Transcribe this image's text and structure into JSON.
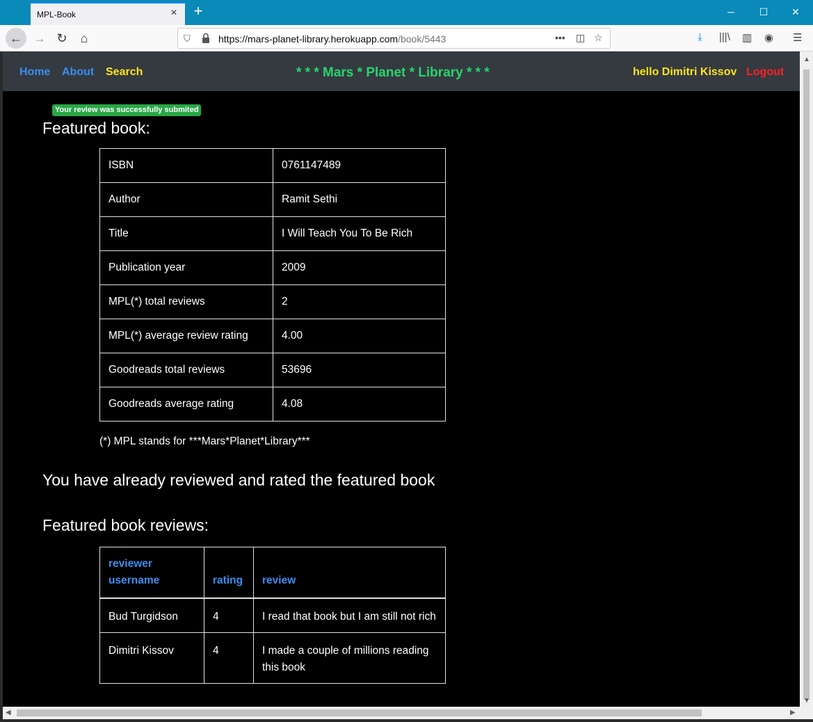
{
  "browser": {
    "tab_title": "MPL-Book",
    "url_host": "https://mars-planet-library.herokuapp.com",
    "url_path": "/book/5443",
    "colors": {
      "titlebar": "#0a8ab8",
      "tab_accent": "#0a84ff"
    }
  },
  "nav": {
    "home": "Home",
    "about": "About",
    "search": "Search",
    "brand": "* * * Mars * Planet * Library * * *",
    "greeting": "hello Dimitri Kissov",
    "logout": "Logout",
    "colors": {
      "link": "#3b8ef0",
      "search": "#ffe319",
      "brand": "#28d46c",
      "logout": "#ff2020"
    }
  },
  "flash_message": "Your review was successfully submited",
  "featured_heading": "Featured book:",
  "book": [
    {
      "label": "ISBN",
      "value": "0761147489"
    },
    {
      "label": "Author",
      "value": "Ramit Sethi"
    },
    {
      "label": "Title",
      "value": "I Will Teach You To Be Rich"
    },
    {
      "label": "Publication year",
      "value": "2009"
    },
    {
      "label": "MPL(*) total reviews",
      "value": "2"
    },
    {
      "label": "MPL(*) average review rating",
      "value": "4.00"
    },
    {
      "label": "Goodreads total reviews",
      "value": "53696"
    },
    {
      "label": "Goodreads average rating",
      "value": "4.08"
    }
  ],
  "footnote": "(*) MPL stands for ***Mars*Planet*Library***",
  "already_reviewed": "You have already reviewed and rated the featured book",
  "reviews_heading": "Featured book reviews:",
  "reviews": {
    "headers": [
      "reviewer username",
      "rating",
      "review"
    ],
    "rows": [
      {
        "user": "Bud Turgidson",
        "rating": "4",
        "review": "I read that book but I am still not rich"
      },
      {
        "user": "Dimitri Kissov",
        "rating": "4",
        "review": "I made a couple of millions reading this book"
      }
    ]
  }
}
